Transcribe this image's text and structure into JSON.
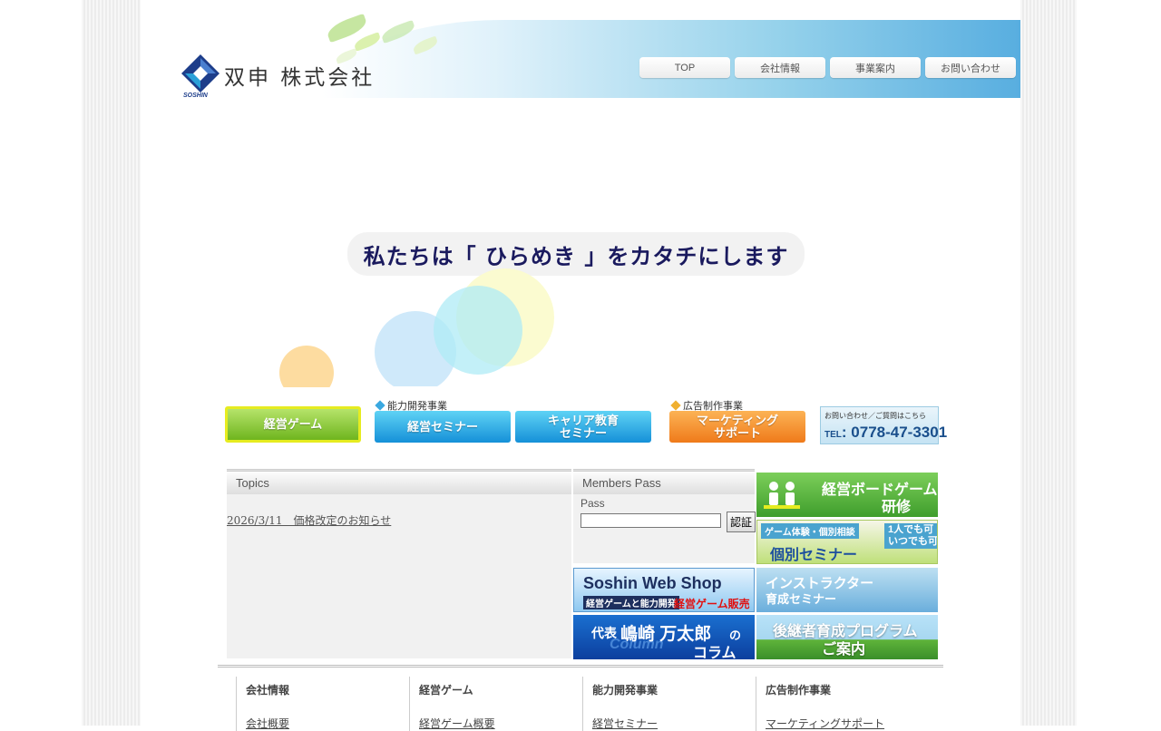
{
  "header": {
    "company_name": "双申 株式会社",
    "logo_sub": "SOSHIN",
    "nav": [
      "TOP",
      "会社情報",
      "事業案内",
      "お問い合わせ"
    ]
  },
  "hero": {
    "tagline": "私たちは「 ひらめき 」をカタチにします"
  },
  "services": {
    "category_ability": "能力開発事業",
    "category_ad": "広告制作事業",
    "keiei_game": "経営ゲーム",
    "keiei_seminar": "経営セミナー",
    "career_line1": "キャリア教育",
    "career_line2": "セミナー",
    "marketing_line1": "マーケティング",
    "marketing_line2": "サポート",
    "contact_small": "お問い合わせ／ご質問はこちら",
    "tel_prefix": "TEL",
    "tel_number": "0778-47-3301"
  },
  "topics": {
    "title": "Topics",
    "items": [
      "2026/3/11　価格改定のお知らせ"
    ]
  },
  "members": {
    "title": "Members Pass",
    "pass_label": "Pass",
    "pass_value": "",
    "auth_button": "認証"
  },
  "banners": {
    "board_game_line1": "経営ボードゲーム",
    "board_game_line2": "研修",
    "individual_top": "ゲーム体験・個別相談",
    "individual_main": "個別セミナー",
    "individual_side1": "1人でも可",
    "individual_side2": "いつでも可",
    "webshop_title": "Soshin Web Shop",
    "webshop_sub": "経営ゲームと能力開発",
    "webshop_red": "経営ゲーム販売",
    "instructor_line1": "インストラクター",
    "instructor_line2": "育成セミナー",
    "column_prefix": "代表",
    "column_name": "嶋崎 万太郎",
    "column_no": "の",
    "column_word": "コラム",
    "column_script": "Column",
    "successor_line1": "後継者育成プログラム",
    "successor_line2": "ご案内"
  },
  "sitemap": [
    {
      "title": "会社情報",
      "link": "会社概要"
    },
    {
      "title": "経営ゲーム",
      "link": "経営ゲーム概要"
    },
    {
      "title": "能力開発事業",
      "link": "経営セミナー"
    },
    {
      "title": "広告制作事業",
      "link": "マーケティングサポート"
    }
  ],
  "colors": {
    "brand_blue": "#1d3d8a",
    "tagline": "#1a1a5e",
    "green_button": "#6fb51e",
    "blue_button": "#1590d8",
    "orange_button": "#ef7a1a"
  }
}
